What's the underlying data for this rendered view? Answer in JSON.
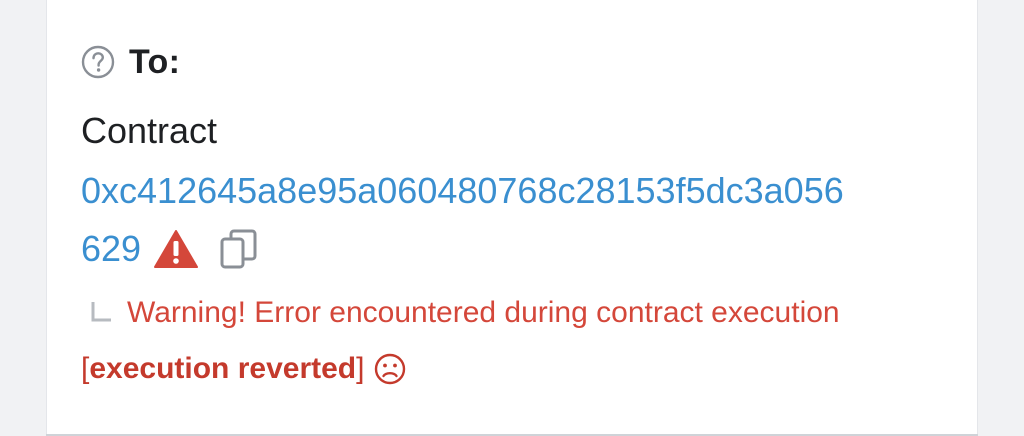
{
  "to": {
    "label": "To:"
  },
  "recipient": {
    "kind": "Contract",
    "address_line1": "0xc412645a8e95a060480768c28153f5dc3a056",
    "address_line2": "629"
  },
  "warning": {
    "message": "Warning! Error encountered during contract execution"
  },
  "revert": {
    "bracket_open": "[",
    "text": "execution reverted",
    "bracket_close": "]"
  },
  "colors": {
    "link": "#3a8fd0",
    "error": "#d4473a",
    "text": "#1e2023",
    "icon_gray": "#8a8f96"
  },
  "icons": [
    "question-circle-icon",
    "warning-triangle-icon",
    "copy-icon",
    "elbow-arrow-icon",
    "sad-face-icon"
  ]
}
